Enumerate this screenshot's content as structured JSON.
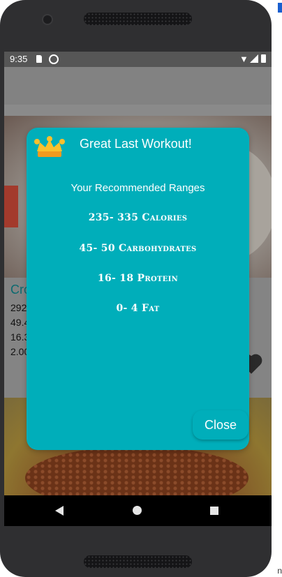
{
  "status_bar": {
    "time": "9:35",
    "icons": [
      "sd-card-icon",
      "sync-icon",
      "wifi-icon",
      "signal-icon",
      "battery-icon"
    ]
  },
  "background_card": {
    "title": "Cro",
    "lines": [
      "292",
      "49.4",
      "16.3",
      "2.00"
    ]
  },
  "dialog": {
    "icon": "crown-icon",
    "title": "Great Last Workout!",
    "heading": "Your Recommended Ranges",
    "ranges": [
      "235- 335 Calories",
      "45- 50 Carbohydrates",
      "16- 18 Protein",
      "0- 4 Fat"
    ],
    "close_label": "Close",
    "background_color": "#00aeba"
  },
  "nav_bar": {
    "icons": [
      "back-icon",
      "home-icon",
      "recents-icon"
    ]
  }
}
